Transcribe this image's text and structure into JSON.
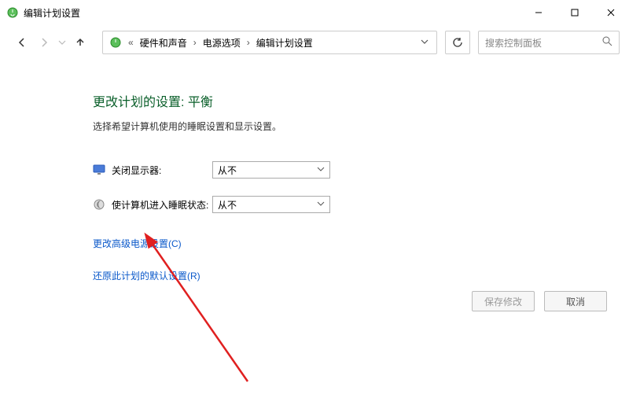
{
  "window": {
    "title": "编辑计划设置"
  },
  "breadcrumbs": {
    "item0": "硬件和声音",
    "item1": "电源选项",
    "item2": "编辑计划设置"
  },
  "search": {
    "placeholder": "搜索控制面板"
  },
  "page": {
    "heading": "更改计划的设置: 平衡",
    "description": "选择希望计算机使用的睡眠设置和显示设置。"
  },
  "settings": {
    "displayOff": {
      "label": "关闭显示器:",
      "value": "从不"
    },
    "sleep": {
      "label": "使计算机进入睡眠状态:",
      "value": "从不"
    }
  },
  "links": {
    "advanced": "更改高级电源设置(C)",
    "restore": "还原此计划的默认设置(R)"
  },
  "buttons": {
    "save": "保存修改",
    "cancel": "取消"
  }
}
